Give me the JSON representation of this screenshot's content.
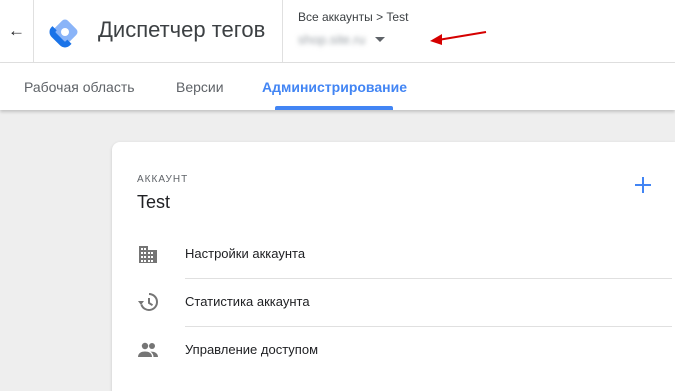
{
  "header": {
    "back_icon": "arrow-back-icon",
    "logo_icon": "tag-manager-logo",
    "app_title": "Диспетчер тегов",
    "breadcrumb": "Все аккаунты  >  Test",
    "container_name": "shop.site.ru",
    "caret_icon": "caret-down-icon",
    "annotation_color": "#d50000"
  },
  "tabs": [
    {
      "label": "Рабочая область",
      "active": false
    },
    {
      "label": "Версии",
      "active": false
    },
    {
      "label": "Администрирование",
      "active": true
    }
  ],
  "account_card": {
    "section_label": "АККАУНТ",
    "account_name": "Test",
    "add_icon": "add-icon",
    "items": [
      {
        "label": "Настройки аккаунта",
        "icon": "building-icon"
      },
      {
        "label": "Статистика аккаунта",
        "icon": "history-icon"
      },
      {
        "label": "Управление доступом",
        "icon": "people-icon"
      }
    ]
  },
  "colors": {
    "accent": "#4285f4",
    "logo_light": "#8ab4f8",
    "logo_dark": "#1a73e8",
    "page_background": "#eeeeee"
  }
}
